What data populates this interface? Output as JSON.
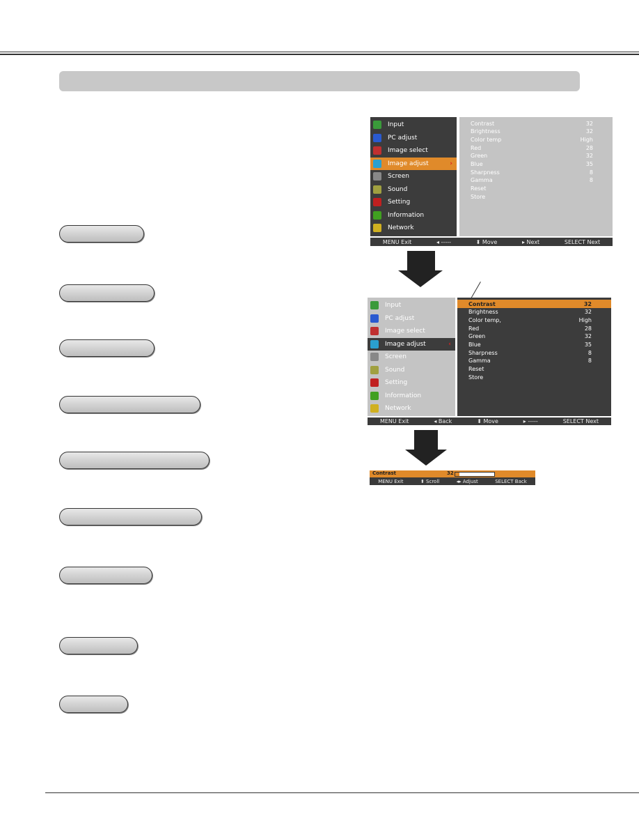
{
  "menu_items": [
    {
      "label": "Input",
      "icon": "input-icon",
      "color": "#3a9a3a"
    },
    {
      "label": "PC adjust",
      "icon": "pc-adjust-icon",
      "color": "#2a5ad0"
    },
    {
      "label": "Image select",
      "icon": "image-select-icon",
      "color": "#c03030"
    },
    {
      "label": "Image adjust",
      "icon": "image-adjust-icon",
      "color": "#2aa0d0"
    },
    {
      "label": "Screen",
      "icon": "screen-icon",
      "color": "#888888"
    },
    {
      "label": "Sound",
      "icon": "sound-icon",
      "color": "#a0a040"
    },
    {
      "label": "Setting",
      "icon": "setting-icon",
      "color": "#c02020"
    },
    {
      "label": "Information",
      "icon": "information-icon",
      "color": "#40a020"
    },
    {
      "label": "Network",
      "icon": "network-icon",
      "color": "#d0b020"
    }
  ],
  "menu1": {
    "submenu": [
      [
        "Contrast",
        "32"
      ],
      [
        "Brightness",
        "32"
      ],
      [
        "Color temp",
        "High"
      ],
      [
        "Red",
        "28"
      ],
      [
        "Green",
        "32"
      ],
      [
        "Blue",
        "35"
      ],
      [
        "Sharpness",
        "8"
      ],
      [
        "Gamma",
        "8"
      ],
      [
        "Reset",
        ""
      ],
      [
        "Store",
        ""
      ]
    ],
    "footer": [
      "MENU Exit",
      "◂ -----",
      "⬍ Move",
      "▸ Next",
      "SELECT Next"
    ]
  },
  "menu2": {
    "submenu": [
      [
        "Contrast",
        "32"
      ],
      [
        "Brightness",
        "32"
      ],
      [
        "Color temp,",
        "High"
      ],
      [
        "Red",
        "28"
      ],
      [
        "Green",
        "32"
      ],
      [
        "Blue",
        "35"
      ],
      [
        "Sharpness",
        "8"
      ],
      [
        "Gamma",
        "8"
      ],
      [
        "Reset",
        ""
      ],
      [
        "Store",
        ""
      ]
    ],
    "footer": [
      "MENU Exit",
      "◂ Back",
      "⬍ Move",
      "▸ -----",
      "SELECT Next"
    ]
  },
  "adjust_bar": {
    "label": "Contrast",
    "value": "32",
    "level_percent": 10,
    "footer": [
      "MENU Exit",
      "⬍ Scroll",
      "◂▸ Adjust",
      "SELECT Back"
    ]
  },
  "colors": {
    "highlight": "#e08a2a",
    "dark_panel": "#3c3c3c",
    "light_panel": "#c4c4c4"
  }
}
